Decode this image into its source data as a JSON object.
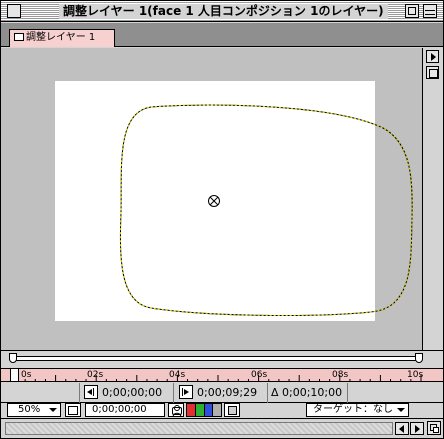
{
  "window": {
    "title": "調整レイヤー 1(face 1 人目コンポジション 1のレイヤー)"
  },
  "tab": {
    "label": "調整レイヤー 1"
  },
  "viewer": {
    "canvas_color": "#ffffff",
    "pasteboard_color": "#c0c0c0",
    "mask_color": "#e8e000"
  },
  "timeline": {
    "ticks": [
      "0s",
      "02s",
      "04s",
      "06s",
      "08s",
      "10s"
    ],
    "ruler_color": "#f3c6c6"
  },
  "time_controls": {
    "in_point": "0;00;00;00",
    "out_point": "0;00;09;29",
    "duration": "Δ 0;00;10;00"
  },
  "bottom_bar": {
    "zoom": "50%",
    "current_time": "0;00;00;00",
    "target_label": "ターゲット：なし",
    "channel_colors": [
      "#e03030",
      "#30b030",
      "#3050e0",
      "#b0b0b0"
    ]
  }
}
